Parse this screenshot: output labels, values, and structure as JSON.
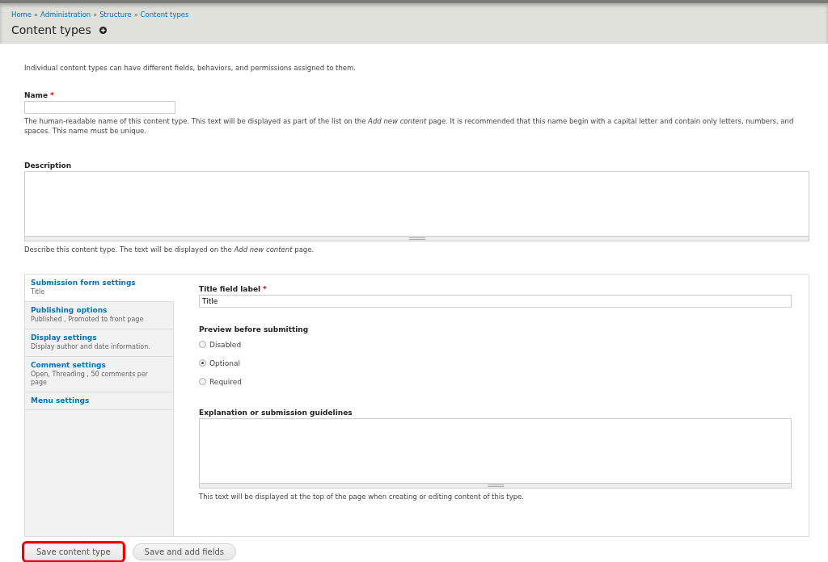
{
  "breadcrumb": [
    "Home",
    "Administration",
    "Structure",
    "Content types"
  ],
  "breadcrumb_separator": "»",
  "title": "Content types",
  "intro": "Individual content types can have different fields, behaviors, and permissions assigned to them.",
  "name_field": {
    "label": "Name",
    "required_mark": "*",
    "description": "The human-readable name of this content type. This text will be displayed as part of the list on the *Add new content* page. It is recommended that this name begin with a capital letter and contain only letters, numbers, and spaces. This name must be unique."
  },
  "description_field": {
    "label": "Description",
    "description": "Describe this content type. The text will be displayed on the *Add new content* page."
  },
  "vertical_tabs": [
    {
      "title": "Submission form settings",
      "summary": "Title",
      "selected": true
    },
    {
      "title": "Publishing options",
      "summary": "Published , Promoted to front page",
      "selected": false
    },
    {
      "title": "Display settings",
      "summary": "Display author and date information.",
      "selected": false
    },
    {
      "title": "Comment settings",
      "summary": "Open, Threading , 50 comments per page",
      "selected": false
    },
    {
      "title": "Menu settings",
      "selected": false
    }
  ],
  "pane": {
    "title_label": {
      "label": "Title field label",
      "required_mark": "*",
      "value": "Title"
    },
    "preview": {
      "label": "Preview before submitting",
      "options": [
        {
          "label": "Disabled",
          "selected": false
        },
        {
          "label": "Optional",
          "selected": true
        },
        {
          "label": "Required",
          "selected": false
        }
      ]
    },
    "guidelines": {
      "label": "Explanation or submission guidelines",
      "description": "This text will be displayed at the top of the page when creating or editing content of this type."
    }
  },
  "actions": [
    {
      "label": "Save content type",
      "highlighted": true
    },
    {
      "label": "Save and add fields",
      "highlighted": false
    }
  ]
}
